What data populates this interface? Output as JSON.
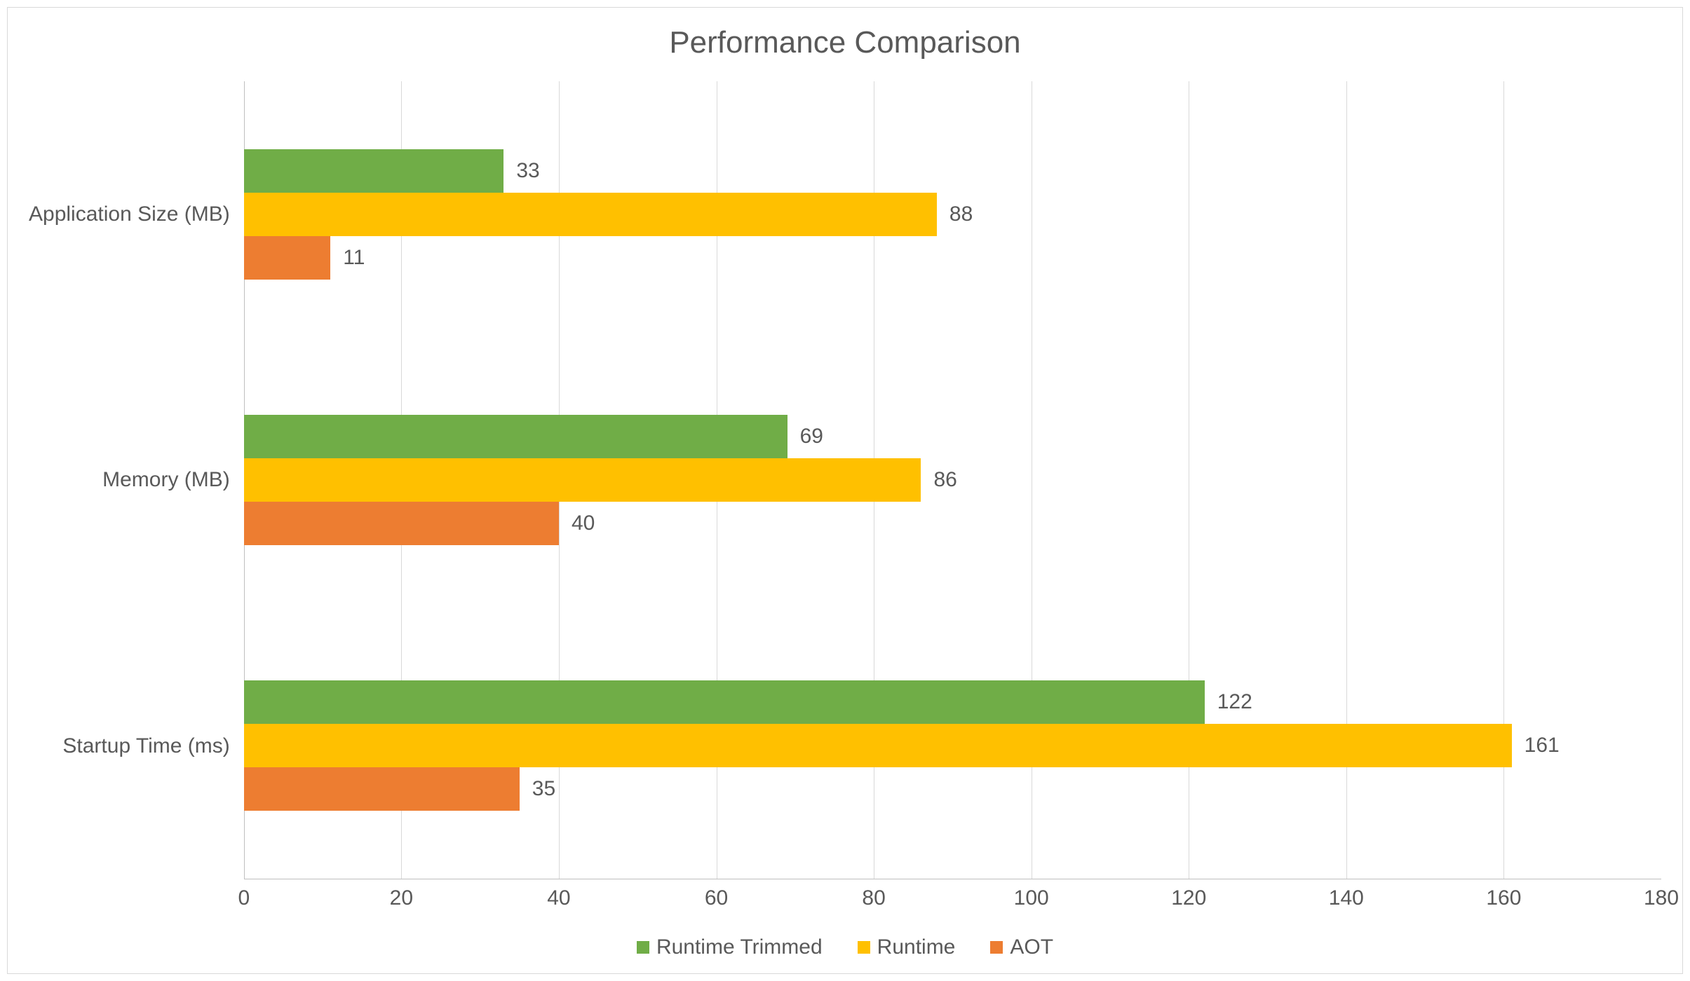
{
  "chart_data": {
    "type": "bar",
    "orientation": "horizontal",
    "title": "Performance Comparison",
    "categories": [
      "Startup Time (ms)",
      "Memory (MB)",
      "Application Size (MB)"
    ],
    "series": [
      {
        "name": "Runtime Trimmed",
        "color": "#70ad47",
        "values": [
          122,
          69,
          33
        ]
      },
      {
        "name": "Runtime",
        "color": "#ffc000",
        "values": [
          161,
          86,
          88
        ]
      },
      {
        "name": "AOT",
        "color": "#ed7d31",
        "values": [
          35,
          40,
          11
        ]
      }
    ],
    "xlabel": "",
    "ylabel": "",
    "x_ticks": [
      0,
      20,
      40,
      60,
      80,
      100,
      120,
      140,
      160,
      180
    ],
    "xlim": [
      0,
      180
    ],
    "legend_position": "bottom",
    "grid": true
  }
}
